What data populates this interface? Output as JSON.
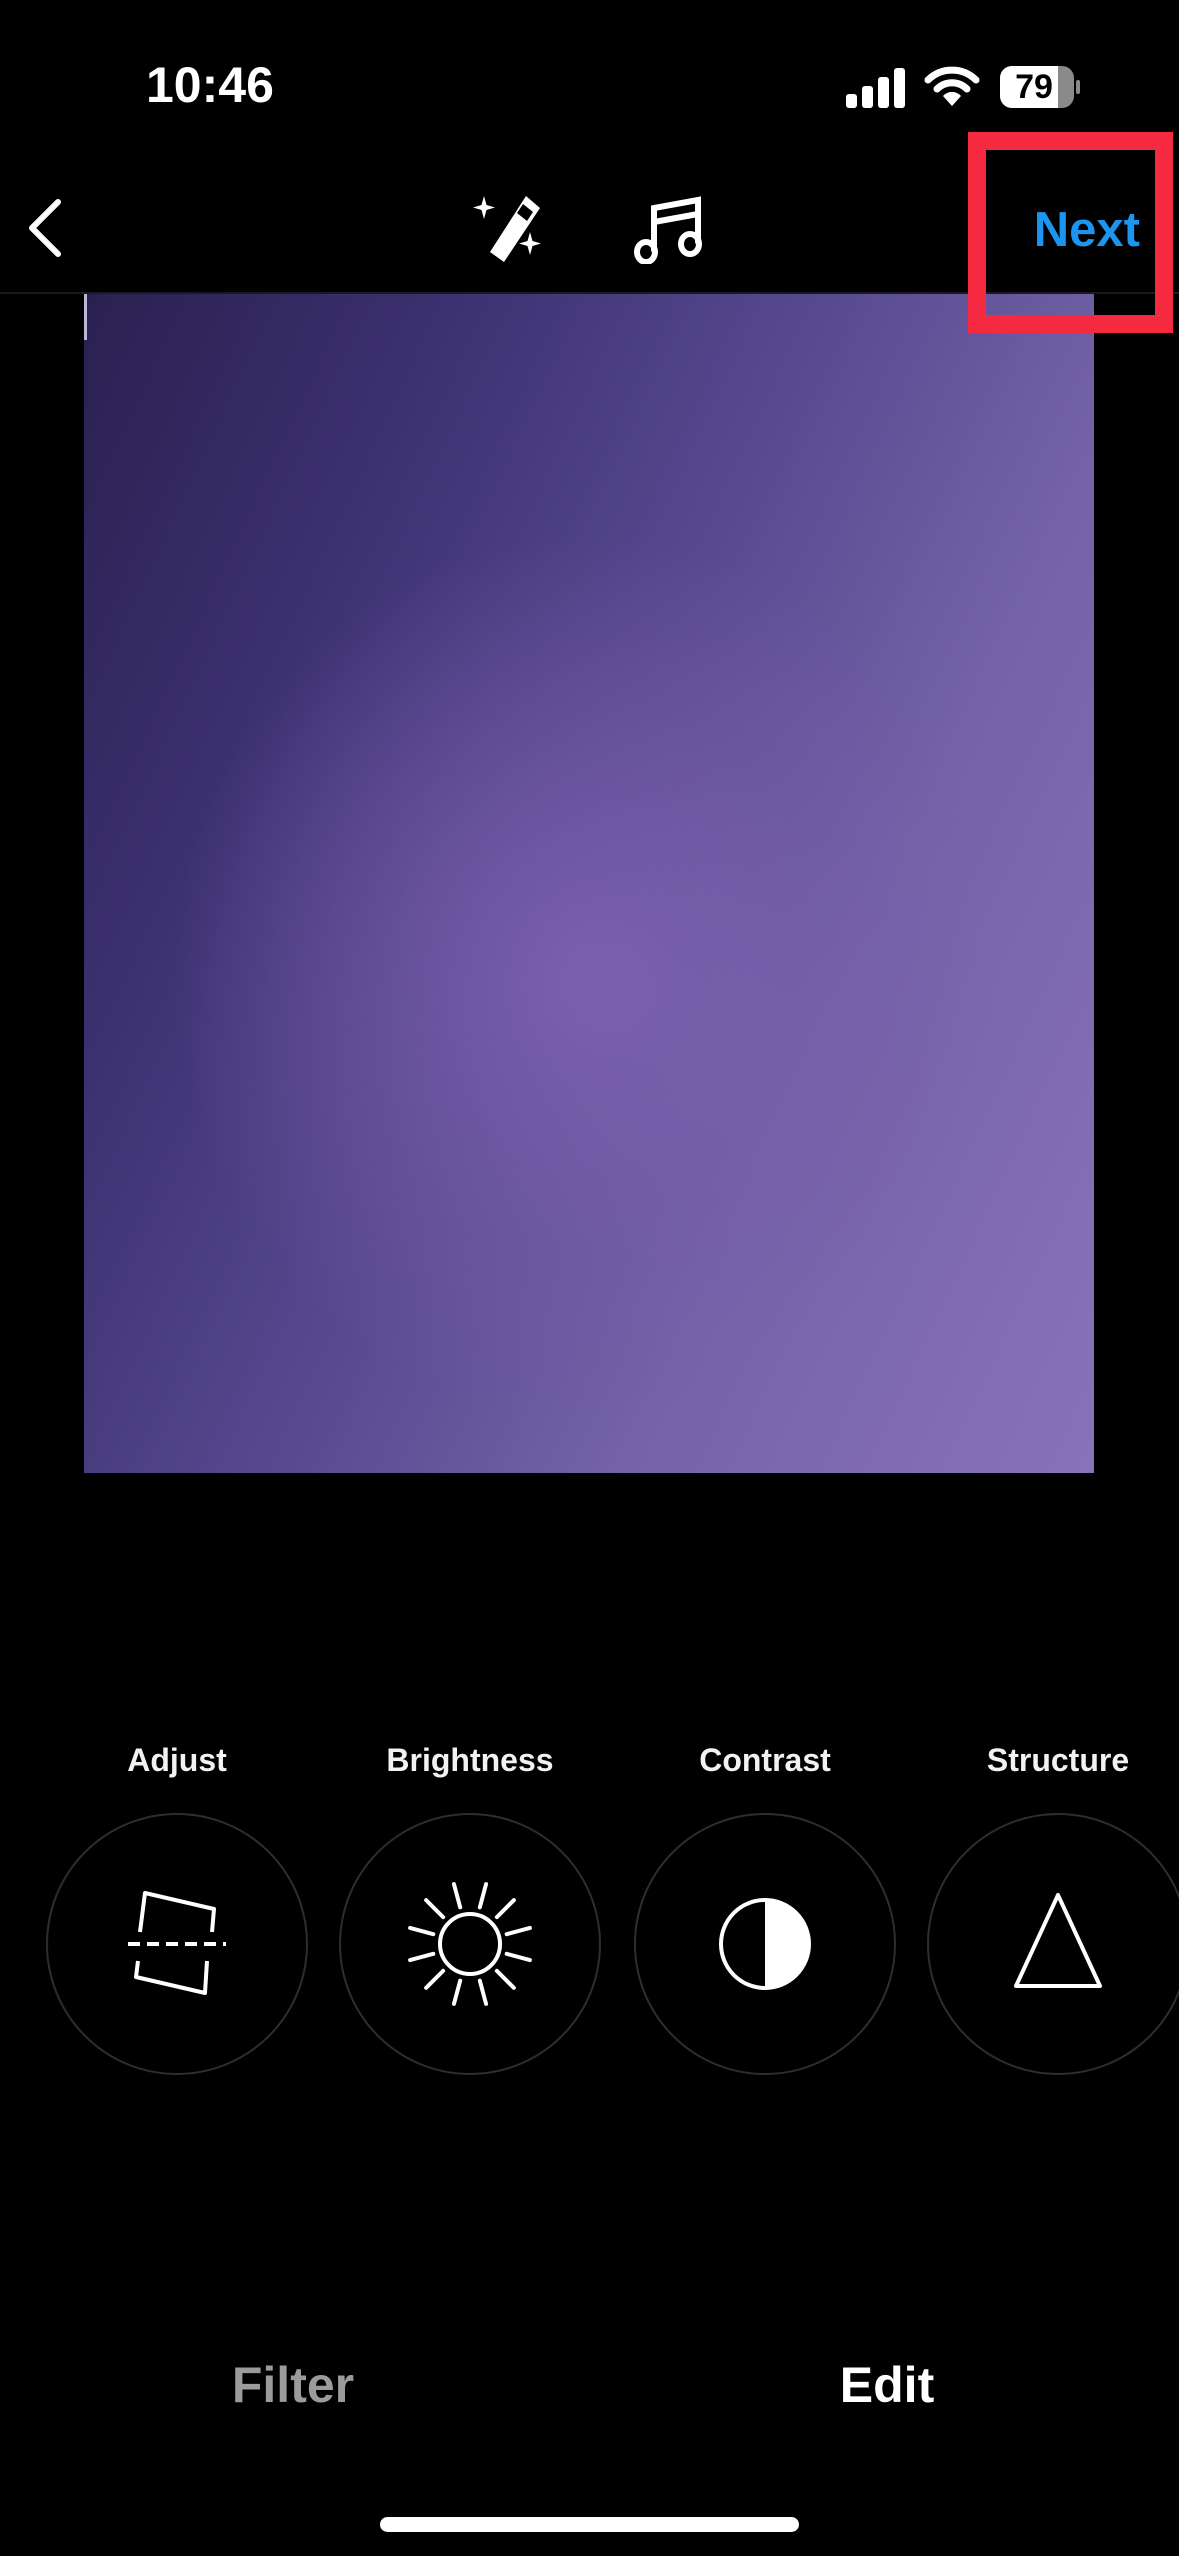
{
  "status_bar": {
    "time": "10:46",
    "battery_level": "79",
    "icons": [
      "cellular-signal-icon",
      "wifi-icon",
      "battery-icon"
    ]
  },
  "nav_bar": {
    "back_icon": "chevron-left-icon",
    "center_icons": [
      "magic-wand-icon",
      "music-note-icon"
    ],
    "next_label": "Next",
    "accent_color": "#1b95f0",
    "highlight_color": "#f5293f"
  },
  "photo": {
    "description": "purple gradient photo preview"
  },
  "tools": [
    {
      "label": "Adjust",
      "icon": "adjust-crop-icon"
    },
    {
      "label": "Brightness",
      "icon": "sun-icon"
    },
    {
      "label": "Contrast",
      "icon": "half-circle-contrast-icon"
    },
    {
      "label": "Structure",
      "icon": "triangle-icon"
    }
  ],
  "tabs": [
    {
      "label": "Filter",
      "active": false
    },
    {
      "label": "Edit",
      "active": true
    }
  ]
}
